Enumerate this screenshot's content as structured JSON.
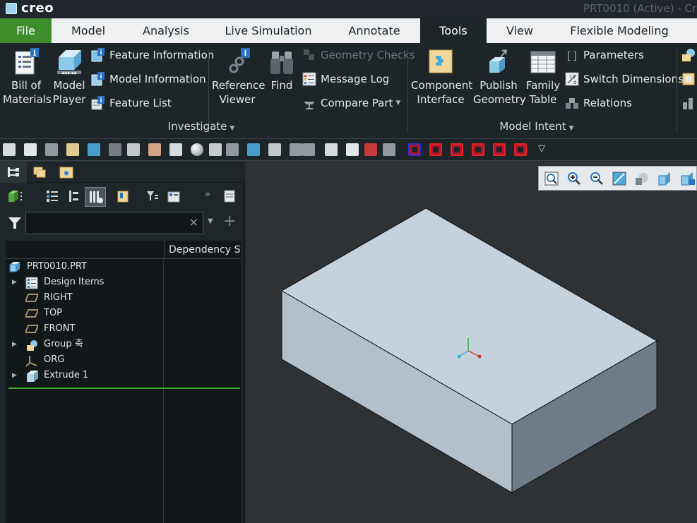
{
  "app": {
    "logo": "creo",
    "window_title": "PRT0010 (Active) - Cr"
  },
  "tabs": [
    "File",
    "Model",
    "Analysis",
    "Live Simulation",
    "Annotate",
    "Tools",
    "View",
    "Flexible Modeling"
  ],
  "active_tab": "Tools",
  "ribbon": {
    "investigate": {
      "label": "Investigate",
      "bill_of_materials": [
        "Bill of",
        "Materials"
      ],
      "model_player": [
        "Model",
        "Player"
      ],
      "feature_information": "Feature Information",
      "model_information": "Model Information",
      "feature_list": "Feature List",
      "reference_viewer": [
        "Reference",
        "Viewer"
      ],
      "find": "Find",
      "geometry_checks": "Geometry Checks",
      "message_log": "Message Log",
      "compare_part": "Compare Part"
    },
    "model_intent": {
      "label": "Model Intent",
      "component_interface": [
        "Component",
        "Interface"
      ],
      "publish_geometry": [
        "Publish",
        "Geometry"
      ],
      "family_table": [
        "Family",
        "Table"
      ],
      "parameters": "Parameters",
      "switch_dimensions": "Switch Dimensions",
      "relations": "Relations"
    }
  },
  "quick_toolbar_icons": [
    "regenerate-icon",
    "new-icon",
    "save-icon",
    "open-icon",
    "close-icon",
    "redo-icon",
    "windows-icon",
    "rename-icon",
    "edit-icon",
    "appearance-icon",
    "measure-icon",
    "datum-display-icon",
    "curve-icon",
    "no-hidden-icon",
    "plane-icon",
    "saved-views-icon",
    "close-window-icon",
    "text-icon",
    "axis-display-icon",
    "point-display-icon",
    "display-style-1-icon",
    "display-style-2-icon",
    "display-style-3-icon",
    "display-style-4-icon",
    "display-style-5-icon",
    "display-style-6-icon",
    "overflow-icon"
  ],
  "model_tree": {
    "filter_placeholder": "",
    "filter_clear": "×",
    "column_header": "Dependency Sta",
    "items": [
      {
        "label": "PRT0010.PRT",
        "icon": "part-icon",
        "expandable": false,
        "level": 0
      },
      {
        "label": "Design Items",
        "icon": "design-items-icon",
        "expandable": true,
        "level": 1
      },
      {
        "label": "RIGHT",
        "icon": "datum-plane-icon",
        "expandable": false,
        "level": 1
      },
      {
        "label": "TOP",
        "icon": "datum-plane-icon",
        "expandable": false,
        "level": 1
      },
      {
        "label": "FRONT",
        "icon": "datum-plane-icon",
        "expandable": false,
        "level": 1
      },
      {
        "label": "Group 축",
        "icon": "group-icon",
        "expandable": true,
        "level": 1
      },
      {
        "label": "ORG",
        "icon": "coordinate-system-icon",
        "expandable": false,
        "level": 1
      },
      {
        "label": "Extrude 1",
        "icon": "extrude-icon",
        "expandable": true,
        "level": 1
      }
    ]
  },
  "colors": {
    "file_tab": "#3f8e2e",
    "ribbon_bg": "#1d2529",
    "part_top_face": "#c5d2dc",
    "part_front_face": "#b3bfc9",
    "part_side_face": "#6f7c87",
    "insert_indicator": "#3fa535"
  }
}
